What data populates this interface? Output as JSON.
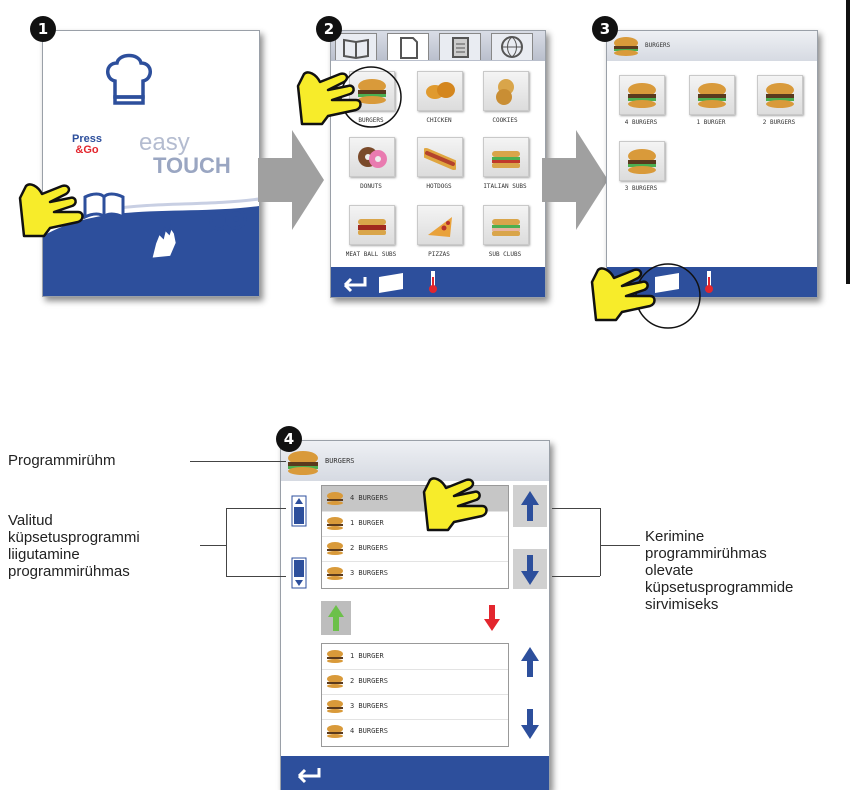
{
  "steps": [
    "1",
    "2",
    "3",
    "4"
  ],
  "screen1": {
    "press_go_top": "Press",
    "press_go_bottom": "&Go",
    "easy": "easy",
    "touch": "TOUCH"
  },
  "screen2": {
    "tiles": [
      "BURGERS",
      "CHICKEN",
      "COOKIES",
      "DONUTS",
      "HOTDOGS",
      "ITALIAN SUBS",
      "MEAT BALL SUBS",
      "PIZZAS",
      "SUB CLUBS"
    ]
  },
  "screen3": {
    "header": "BURGERS",
    "tiles": [
      "4 BURGERS",
      "1 BURGER",
      "2 BURGERS",
      "3 BURGERS"
    ]
  },
  "screen4": {
    "header": "BURGERS",
    "top_list": [
      "4 BURGERS",
      "1 BURGER",
      "2 BURGERS",
      "3 BURGERS"
    ],
    "bottom_list": [
      "1 BURGER",
      "2 BURGERS",
      "3 BURGERS",
      "4 BURGERS"
    ]
  },
  "captions": {
    "program_group": "Programmirühm",
    "move_selected": [
      "Valitud",
      "küpsetusprogrammi",
      "liigutamine",
      "programmirühmas"
    ],
    "scroll": [
      "Kerimine",
      "programmirühmas",
      "olevate",
      "küpsetusprogrammide",
      "sirvimiseks"
    ]
  },
  "colors": {
    "bar_blue": "#2d4f9c",
    "arrow_gray": "#a0a0a0",
    "hand_yellow": "#f7ec2a",
    "green_arrow": "#6cc04a",
    "red_arrow": "#e3262e"
  }
}
